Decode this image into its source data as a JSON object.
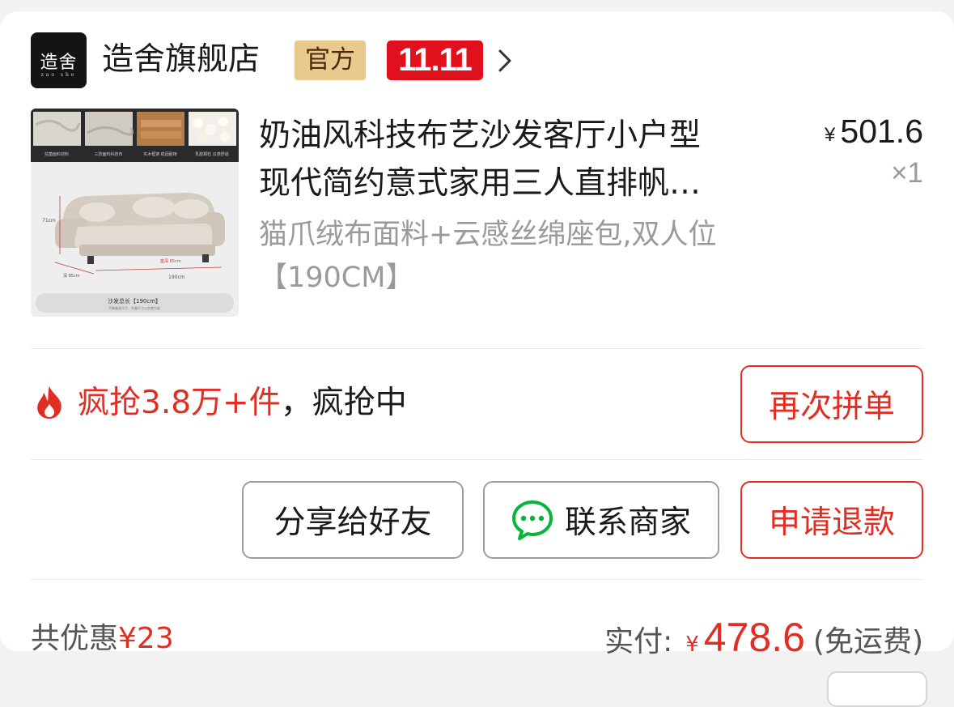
{
  "store": {
    "logo_text": "造舍",
    "logo_sub": "zao she",
    "name": "造舍旗舰店",
    "badge_official": "官方",
    "badge_event": "11.11"
  },
  "product": {
    "title_line1": "奶油风科技布艺沙发客厅小户型",
    "title_line2": "现代简约意式家用三人直排帆…",
    "spec": "猫爪绒布面料+云感丝绵座包,双人位【190CM】",
    "price_symbol": "¥",
    "price": "501.6",
    "quantity": "×1",
    "thumbnail": {
      "captions": [
        "抗菌面料材料",
        "三防面料科技布",
        "实木框架 稳固耐用",
        "乳胶颗粒 云感舒适"
      ],
      "height_label": "71cm",
      "depth_label": "深 95cm",
      "seat_label": "座深 65cm",
      "width_label": "190cm",
      "footer": "沙发总长【190cm】",
      "footer_sub": "不做备选尺寸，外备尺寸以实物为准"
    }
  },
  "promo": {
    "hot_text": "疯抢3.8万+件",
    "rest_text": "，疯抢中"
  },
  "actions": {
    "reorder": "再次拼单",
    "share": "分享给好友",
    "contact": "联系商家",
    "refund": "申请退款"
  },
  "summary": {
    "discount_label": "共优惠",
    "discount_amount": "¥23",
    "paid_label": "实付:",
    "paid_symbol": "¥",
    "paid_amount": "478.6",
    "shipping": "(免运费)"
  },
  "colors": {
    "accent_red": "#e02e24",
    "badge_gold": "#e9c98d",
    "event_red": "#e0101c",
    "wechat_green": "#07b53b"
  }
}
